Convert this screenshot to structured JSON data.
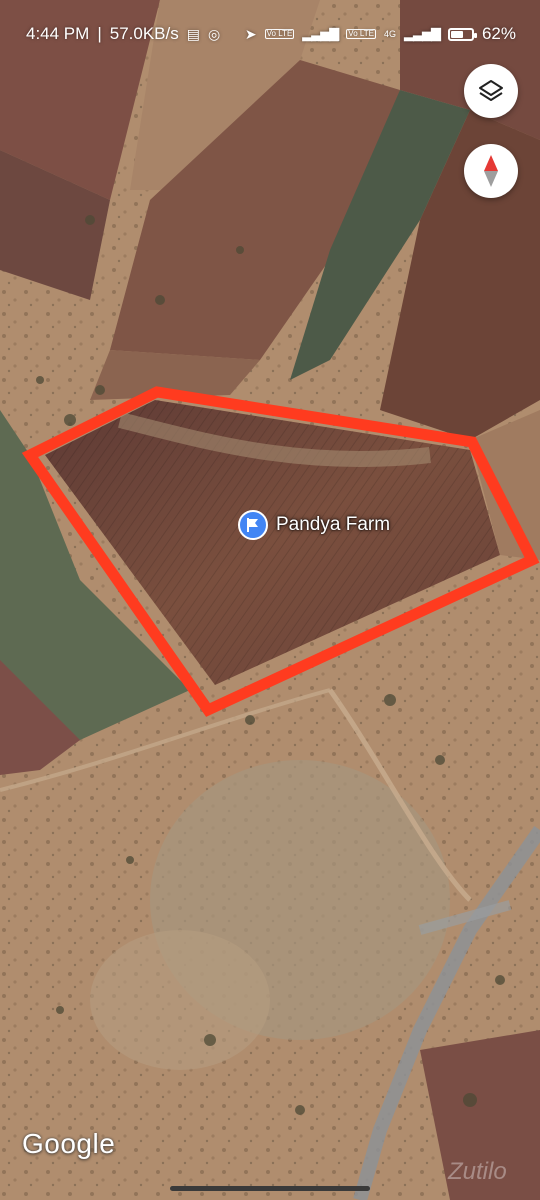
{
  "status_bar": {
    "time": "4:44 PM",
    "network_speed": "57.0KB/s",
    "notification_icons": [
      "document-icon",
      "instagram-icon"
    ],
    "right_icons": [
      "location-arrow-icon",
      "volte-icon",
      "signal-icon",
      "volte-icon",
      "4g-signal-icon"
    ],
    "volte_label": "Vo LTE",
    "network_type": "4G",
    "battery_percent": "62%",
    "battery_level": 0.62
  },
  "map": {
    "view": "satellite",
    "place_marker": {
      "name": "Pandya Farm",
      "icon": "flag-icon",
      "color": "#4285f4"
    },
    "boundary": {
      "color": "#ff3b1f",
      "shape": "hand-drawn outline around the farm field"
    },
    "attribution": "Google",
    "watermark": "Zutilo"
  },
  "controls": {
    "layers_button": {
      "icon": "layers-icon"
    },
    "compass_button": {
      "icon": "compass-icon",
      "colors": [
        "#e53935",
        "#9e9e9e"
      ]
    }
  }
}
